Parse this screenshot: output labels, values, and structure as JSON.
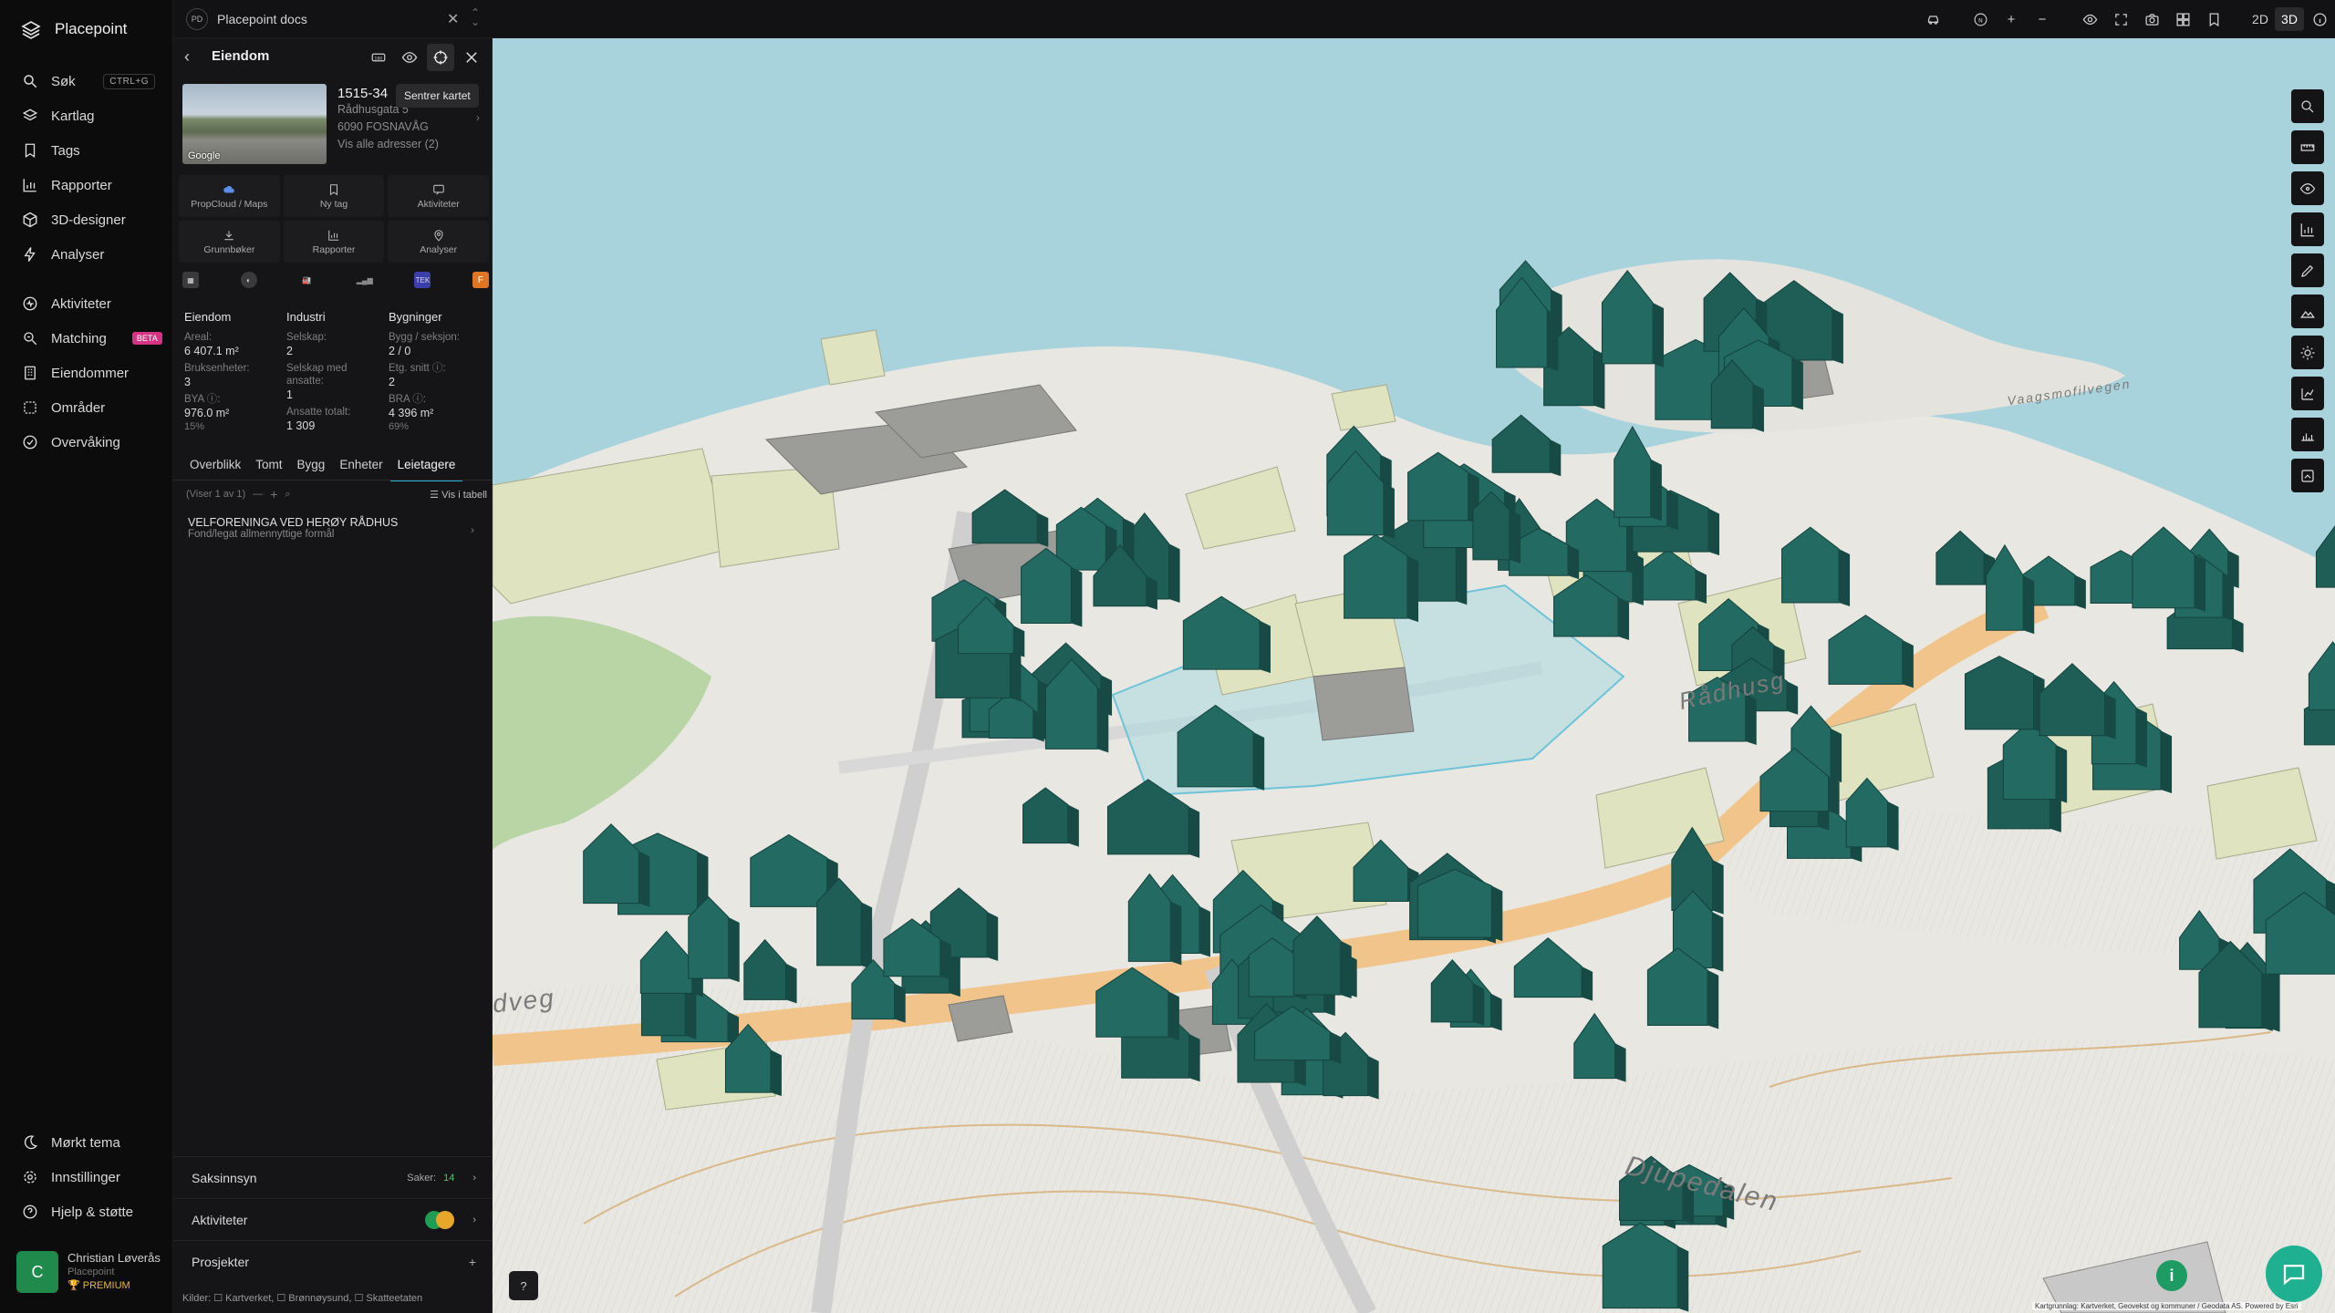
{
  "app": {
    "name": "Placepoint"
  },
  "nav": {
    "items": [
      {
        "label": "Søk",
        "shortcut": "CTRL+G"
      },
      {
        "label": "Kartlag"
      },
      {
        "label": "Tags"
      },
      {
        "label": "Rapporter"
      },
      {
        "label": "3D-designer"
      },
      {
        "label": "Analyser"
      }
    ],
    "items2": [
      {
        "label": "Aktiviteter"
      },
      {
        "label": "Matching",
        "badge": "BETA"
      },
      {
        "label": "Eiendommer"
      },
      {
        "label": "Områder"
      },
      {
        "label": "Overvåking"
      }
    ],
    "bottom": [
      {
        "label": "Mørkt tema"
      },
      {
        "label": "Innstillinger"
      },
      {
        "label": "Hjelp & støtte"
      }
    ],
    "user": {
      "initial": "C",
      "name": "Christian Løverås",
      "org": "Placepoint",
      "plan": "PREMIUM"
    }
  },
  "topbar": {
    "doc_badge": "PD",
    "doc_name": "Placepoint docs",
    "view_2d": "2D",
    "view_3d": "3D",
    "compass": "N"
  },
  "panel": {
    "title": "Eiendom",
    "tooltip": "Sentrer kartet",
    "photo_credit": "Google",
    "gnr": "1515-34",
    "address_lines": [
      "Rådhusgata 5",
      "6090 FOSNAVÅG",
      "Vis alle adresser (2)"
    ],
    "actions": [
      "PropCloud / Maps",
      "Ny tag",
      "Aktiviteter",
      "Grunnbøker",
      "Rapporter",
      "Analyser"
    ],
    "source_badges": [
      "TEK",
      "F"
    ],
    "stats": {
      "col1": {
        "head": "Eiendom",
        "rows": [
          {
            "label": "Areal:",
            "value": "6 407.1 m²"
          },
          {
            "label": "Bruksenheter:",
            "value": "3"
          },
          {
            "label": "BYA ⓘ:",
            "value": "976.0 m²",
            "pct": "15%"
          }
        ]
      },
      "col2": {
        "head": "Industri",
        "rows": [
          {
            "label": "Selskap:",
            "value": "2"
          },
          {
            "label": "Selskap med ansatte:",
            "value": "1"
          },
          {
            "label": "Ansatte totalt:",
            "value": "1 309"
          }
        ]
      },
      "col3": {
        "head": "Bygninger",
        "rows": [
          {
            "label": "Bygg / seksjon:",
            "value": "2 / 0"
          },
          {
            "label": "Etg. snitt ⓘ:",
            "value": "2"
          },
          {
            "label": "BRA ⓘ:",
            "value": "4 396 m²",
            "pct": "69%"
          }
        ]
      }
    },
    "tabs": [
      "Overblikk",
      "Tomt",
      "Bygg",
      "Enheter",
      "Leietagere"
    ],
    "active_tab": "Leietagere",
    "sub": {
      "count": "(Viser 1 av 1)",
      "table": "Vis i tabell"
    },
    "lessee": {
      "name": "VELFORENINGA VED HERØY RÅDHUS",
      "type": "Fond/legat allmennyttige formål"
    },
    "sections": {
      "saksinnsyn": {
        "label": "Saksinnsyn",
        "prefix": "Saker:",
        "count": "14"
      },
      "aktiviteter": {
        "label": "Aktiviteter"
      },
      "prosjekter": {
        "label": "Prosjekter",
        "action": "+"
      }
    },
    "sources": "Kilder: ☐ Kartverket, ☐ Brønnøysund, ☐ Skatteetaten"
  },
  "map": {
    "streets": [
      "Rådhusg",
      "Djupedalen",
      "dveg",
      "Vaagsmofilvegen"
    ],
    "attribution": "Kartgrunnlag: Kartverket, Geovekst og kommuner / Geodata AS. Powered by Esri",
    "info": "i"
  }
}
